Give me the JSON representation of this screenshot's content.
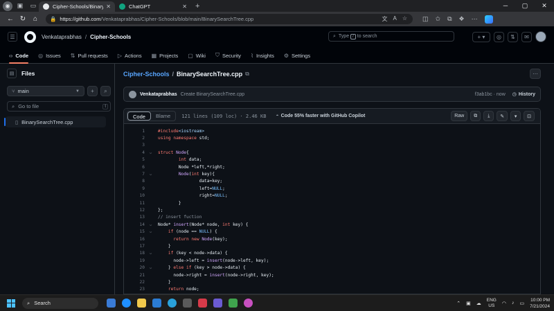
{
  "browser": {
    "tabs": [
      {
        "label": "Cipher-Schools/BinarySearchTre...",
        "active": true
      },
      {
        "label": "ChatGPT",
        "active": false
      }
    ],
    "url_host": "https://github.com",
    "url_path": "/Venkataprabhas/Cipher-Schools/blob/main/BinarySearchTree.cpp"
  },
  "header": {
    "owner": "Venkataprabhas",
    "repo": "Cipher-Schools",
    "search_placeholder_a": "Type",
    "search_key": "/",
    "search_placeholder_b": "to search",
    "plus_label": "+ ▾"
  },
  "nav": [
    {
      "label": "Code",
      "icon": "code-icon",
      "glyph": "‹›",
      "selected": true
    },
    {
      "label": "Issues",
      "icon": "issues-icon",
      "glyph": "◎",
      "selected": false
    },
    {
      "label": "Pull requests",
      "icon": "pull-request-icon",
      "glyph": "⇅",
      "selected": false
    },
    {
      "label": "Actions",
      "icon": "actions-icon",
      "glyph": "▷",
      "selected": false
    },
    {
      "label": "Projects",
      "icon": "projects-icon",
      "glyph": "▦",
      "selected": false
    },
    {
      "label": "Wiki",
      "icon": "wiki-icon",
      "glyph": "▢",
      "selected": false
    },
    {
      "label": "Security",
      "icon": "security-icon",
      "glyph": "⛉",
      "selected": false
    },
    {
      "label": "Insights",
      "icon": "insights-icon",
      "glyph": "⌇",
      "selected": false
    },
    {
      "label": "Settings",
      "icon": "settings-icon",
      "glyph": "⚙",
      "selected": false
    }
  ],
  "sidebar": {
    "title": "Files",
    "branch": "main",
    "goto_placeholder": "Go to file",
    "goto_key": "t",
    "files": [
      "BinarySearchTree.cpp"
    ]
  },
  "main": {
    "repo": "Cipher-Schools",
    "file": "BinarySearchTree.cpp",
    "commit": {
      "author": "Venkataprabhas",
      "message": "Create BinarySearchTree.cpp",
      "sha_time": "f3ab1bc · now",
      "history": "History"
    },
    "toolbar": {
      "code": "Code",
      "blame": "Blame",
      "meta": "121 lines (109 loc) · 2.46 KB",
      "copilot": "Code 55% faster with GitHub Copilot",
      "raw": "Raw"
    }
  },
  "code_lines": [
    {
      "n": "1",
      "f": "",
      "h": "<span class=\"kw\">#include</span><span class=\"inc\">&lt;iostream&gt;</span>"
    },
    {
      "n": "2",
      "f": "",
      "h": "<span class=\"kw\">using namespace</span> std;"
    },
    {
      "n": "3",
      "f": "",
      "h": ""
    },
    {
      "n": "4",
      "f": "⌵",
      "h": "<span class=\"kw\">struct</span> <span class=\"fn\">Node</span>{"
    },
    {
      "n": "5",
      "f": "",
      "h": "        <span class=\"ty\">int</span> data;"
    },
    {
      "n": "6",
      "f": "",
      "h": "        Node *left,*right;"
    },
    {
      "n": "7",
      "f": "⌵",
      "h": "        <span class=\"fn\">Node</span>(<span class=\"ty\">int</span> key){"
    },
    {
      "n": "8",
      "f": "",
      "h": "                data=key;"
    },
    {
      "n": "9",
      "f": "",
      "h": "                left=<span class=\"cn\">NULL</span>;"
    },
    {
      "n": "10",
      "f": "",
      "h": "                right=<span class=\"cn\">NULL</span>;"
    },
    {
      "n": "11",
      "f": "",
      "h": "        }"
    },
    {
      "n": "12",
      "f": "",
      "h": "};"
    },
    {
      "n": "13",
      "f": "",
      "h": "<span class=\"cm\">// insert fuction</span>"
    },
    {
      "n": "14",
      "f": "⌵",
      "h": "Node* <span class=\"fn\">insert</span>(Node* node, <span class=\"ty\">int</span> key) {"
    },
    {
      "n": "15",
      "f": "⌵",
      "h": "    <span class=\"kw\">if</span> (node == <span class=\"cn\">NULL</span>) {"
    },
    {
      "n": "16",
      "f": "",
      "h": "      <span class=\"kw\">return new</span> <span class=\"fn\">Node</span>(key);"
    },
    {
      "n": "17",
      "f": "",
      "h": "    }"
    },
    {
      "n": "18",
      "f": "⌵",
      "h": "    <span class=\"kw\">if</span> (key &lt; node-&gt;data) {"
    },
    {
      "n": "19",
      "f": "",
      "h": "      node-&gt;left = <span class=\"fn\">insert</span>(node-&gt;left, key);"
    },
    {
      "n": "20",
      "f": "⌵",
      "h": "    } <span class=\"kw\">else if</span> (key &gt; node-&gt;data) {"
    },
    {
      "n": "21",
      "f": "",
      "h": "      node-&gt;right = <span class=\"fn\">insert</span>(node-&gt;right, key);"
    },
    {
      "n": "22",
      "f": "",
      "h": "    }"
    },
    {
      "n": "23",
      "f": "",
      "h": "    <span class=\"kw\">return</span> node;"
    }
  ],
  "taskbar": {
    "search": "Search",
    "lang1": "ENG",
    "lang2": "US",
    "time": "10:00 PM",
    "date": "7/21/2024"
  }
}
